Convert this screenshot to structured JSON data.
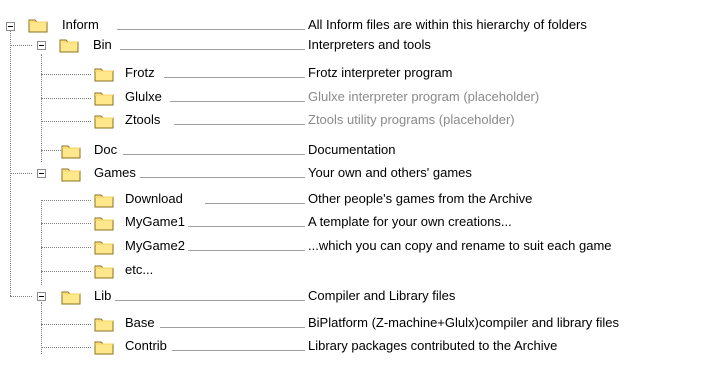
{
  "tree": {
    "rows": [
      {
        "name": "Inform",
        "description": "All Inform files are within this hierarchy of folders",
        "muted": false
      },
      {
        "name": "Bin",
        "description": "Interpreters and tools",
        "muted": false
      },
      {
        "name": "Frotz",
        "description": "Frotz interpreter program",
        "muted": false
      },
      {
        "name": "Glulxe",
        "description": "Glulxe interpreter program (placeholder)",
        "muted": true
      },
      {
        "name": "Ztools",
        "description": "Ztools utility programs (placeholder)",
        "muted": true
      },
      {
        "name": "Doc",
        "description": "Documentation",
        "muted": false
      },
      {
        "name": "Games",
        "description": "Your own and others' games",
        "muted": false
      },
      {
        "name": "Download",
        "description": "Other people's games from the Archive",
        "muted": false
      },
      {
        "name": "MyGame1",
        "description": "A template for your own creations...",
        "muted": false
      },
      {
        "name": "MyGame2",
        "description": "...which you can copy and rename to suit each game",
        "muted": false
      },
      {
        "name": "etc...",
        "description": "",
        "muted": false
      },
      {
        "name": "Lib",
        "description": "Compiler and Library files",
        "muted": false
      },
      {
        "name": "Base",
        "description": "BiPlatform (Z-machine+Glulx)compiler and library files",
        "muted": false
      },
      {
        "name": "Contrib",
        "description": "Library packages contributed to the Archive",
        "muted": false
      }
    ],
    "colors": {
      "folder_fill": "#ffe88c",
      "folder_tab": "#f6d55e",
      "folder_outline": "#8a7220",
      "muted_text": "#8a8a8a",
      "connector": "#808080"
    },
    "icons": {
      "folder": "folder-icon",
      "toggle": "collapse-minus-icon"
    }
  }
}
